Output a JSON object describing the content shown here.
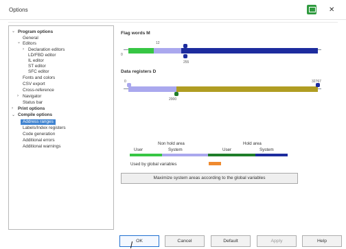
{
  "window": {
    "title": "Options"
  },
  "tree": {
    "items": [
      {
        "label": "Program options"
      },
      {
        "label": "General"
      },
      {
        "label": "Editors"
      },
      {
        "label": "Declaration editors"
      },
      {
        "label": "LD/FBD editor"
      },
      {
        "label": "IL editor"
      },
      {
        "label": "ST editor"
      },
      {
        "label": "SFC editor"
      },
      {
        "label": "Fonts and colors"
      },
      {
        "label": "CSV export"
      },
      {
        "label": "Cross-reference"
      },
      {
        "label": "Navigator"
      },
      {
        "label": "Status bar"
      },
      {
        "label": "Print options"
      },
      {
        "label": "Compile options"
      },
      {
        "label": "Address ranges"
      },
      {
        "label": "Labels/Index registers"
      },
      {
        "label": "Code generation"
      },
      {
        "label": "Additional errors"
      },
      {
        "label": "Additional warnings"
      }
    ]
  },
  "panel": {
    "flag_title": "Flag words M",
    "flag_ticks": {
      "start": "0",
      "marker": "12",
      "end": "255"
    },
    "data_title": "Data registers D",
    "data_ticks": {
      "start": "0",
      "marker": "2000",
      "end": "32767"
    },
    "legend": {
      "non_hold": "Non hold area",
      "hold": "Hold area",
      "user1": "User",
      "system1": "System",
      "user2": "User",
      "system2": "System",
      "global_label": "Used by global variables"
    },
    "maximize_button": "Maximize system areas according to the global variables"
  },
  "buttons": {
    "ok": "OK",
    "cancel": "Cancel",
    "default": "Default",
    "apply": "Apply",
    "help": "Help"
  },
  "colors": {
    "green": "#37c644",
    "lavender": "#aaa8ee",
    "navy": "#1d2c9e",
    "olive": "#b09d22",
    "dark_green": "#1f7d2a",
    "orange": "#ef8a2f",
    "selection": "#3f83d0"
  }
}
